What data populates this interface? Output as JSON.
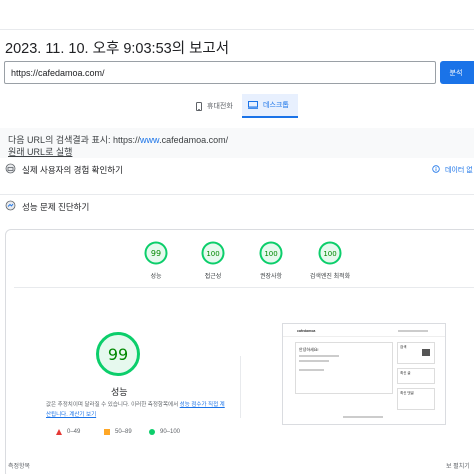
{
  "report": {
    "title": "2023. 11. 10. 오후 9:03:53의 보고서"
  },
  "url_input": {
    "value": "https://cafedamoa.com/",
    "analyze_label": "분석"
  },
  "tabs": [
    {
      "label": "휴대전화",
      "icon": "smartphone-icon",
      "selected": false
    },
    {
      "label": "데스크톱",
      "icon": "desktop-icon",
      "selected": true
    }
  ],
  "notice": {
    "prefix": "다음 URL의 검색결과 표시: https://",
    "highlight": "www",
    "suffix": ".cafedamoa.com/",
    "original_link": "원래 URL로 실행"
  },
  "sections": {
    "field_data": {
      "title": "실제 사용자의 경험 확인하기",
      "right_label": "데이터 없",
      "icon": "info-icon"
    },
    "diagnose": {
      "title": "성능 문제 진단하기",
      "icon": "diagnose-icon"
    }
  },
  "scores": [
    {
      "label": "성능",
      "value": "99"
    },
    {
      "label": "접근성",
      "value": "100"
    },
    {
      "label": "권장사항",
      "value": "100"
    },
    {
      "label": "검색엔진 최적화",
      "value": "100"
    }
  ],
  "performance": {
    "score": "99",
    "label": "성능",
    "desc_text": "값은 추정치이며 달라질 수 있습니다. 이러한 측정항목에서 ",
    "desc_link": "성능 점수가 직접 계산됩니다. 계산기 보기",
    "legend": [
      {
        "range": "0–49",
        "shape": "triangle",
        "color": "#e53935"
      },
      {
        "range": "50–89",
        "shape": "square",
        "color": "#ffa726"
      },
      {
        "range": "90–100",
        "shape": "circle",
        "color": "#0cce6b"
      }
    ]
  },
  "thumbnail": {
    "logo": "cafedamoa",
    "hello": "안녕하세요!",
    "side1": "검색",
    "side2": "최신 글",
    "side3": "최신 댓글"
  },
  "footer": {
    "left": "측정항목",
    "right": "보 펼치기"
  },
  "colors": {
    "accent": "#1a73e8",
    "pass": "#0cce6b",
    "pass_text": "#008800"
  }
}
